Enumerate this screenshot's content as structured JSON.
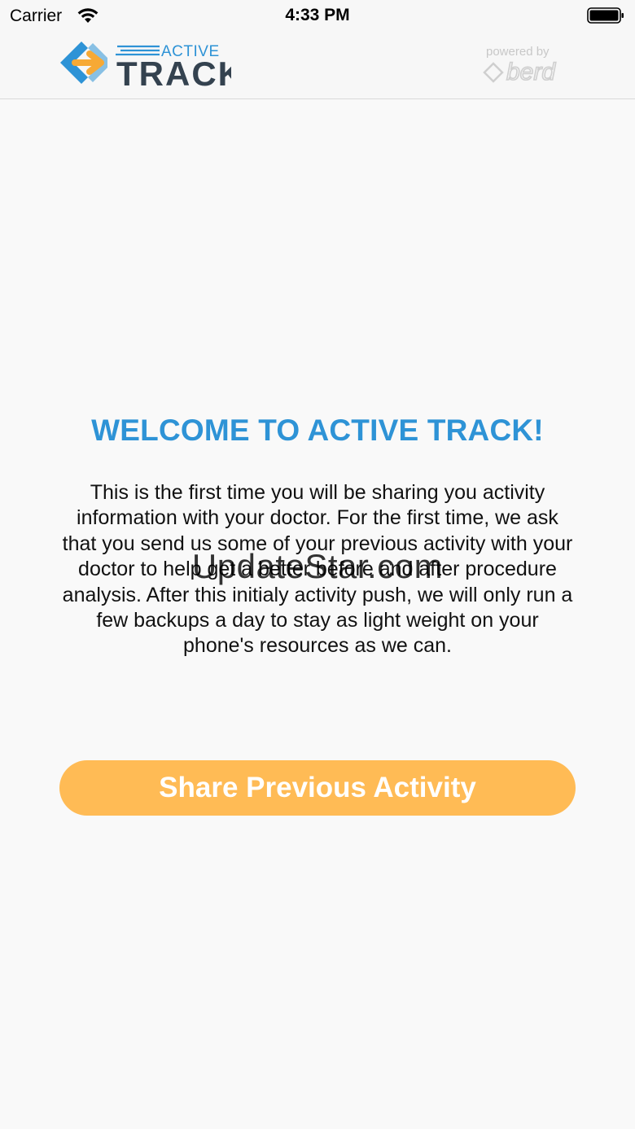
{
  "status_bar": {
    "carrier": "Carrier",
    "time": "4:33 PM"
  },
  "nav_bar": {
    "brand_top": "ACTIVE",
    "brand_bottom": "TRACK",
    "partner_prefix": "powered by",
    "partner_name": "berd"
  },
  "welcome": {
    "title": "WELCOME TO ACTIVE TRACK!",
    "body": "This is the first time you will be sharing you activity information with your doctor. For the first time, we ask that you send us some of your previous activity with your doctor to help get a better before and after procedure analysis. After this initialy activity push, we will only run a few backups a day to stay as light weight on your phone's resources as we can."
  },
  "actions": {
    "share_label": "Share Previous Activity"
  },
  "watermark": "UpdateStar.com",
  "colors": {
    "title_blue": "#2e93d6",
    "button_orange": "#ffbb55",
    "logo_orange": "#f7a935"
  }
}
